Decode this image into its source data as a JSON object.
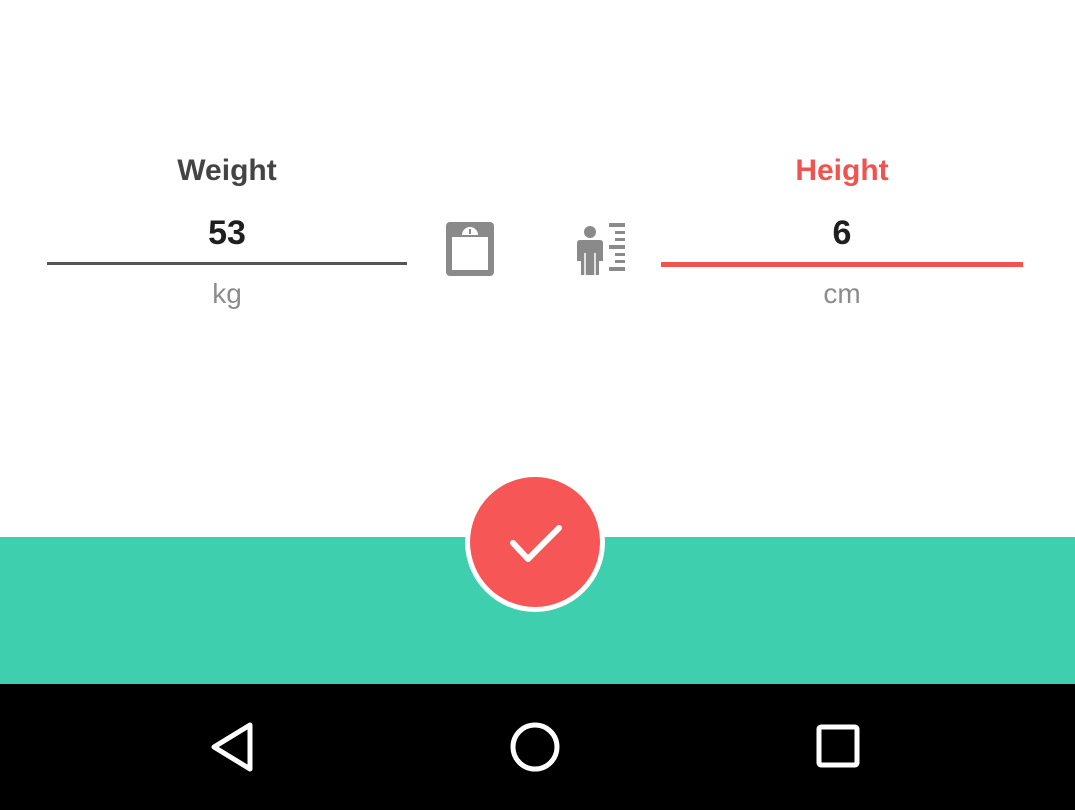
{
  "weight": {
    "label": "Weight",
    "value": "53",
    "unit": "kg"
  },
  "height": {
    "label": "Height",
    "value": "6",
    "unit": "cm"
  },
  "icons": {
    "scale": "scale-icon",
    "height_measure": "height-measure-icon",
    "confirm": "checkmark-icon",
    "nav_back": "back-triangle-icon",
    "nav_home": "home-circle-icon",
    "nav_recents": "recents-square-icon"
  },
  "colors": {
    "accent": "#f05350",
    "button": "#f75656",
    "band": "#3ecfae",
    "label": "#444444",
    "unit": "#8c8c8c",
    "navbar": "#000000"
  }
}
